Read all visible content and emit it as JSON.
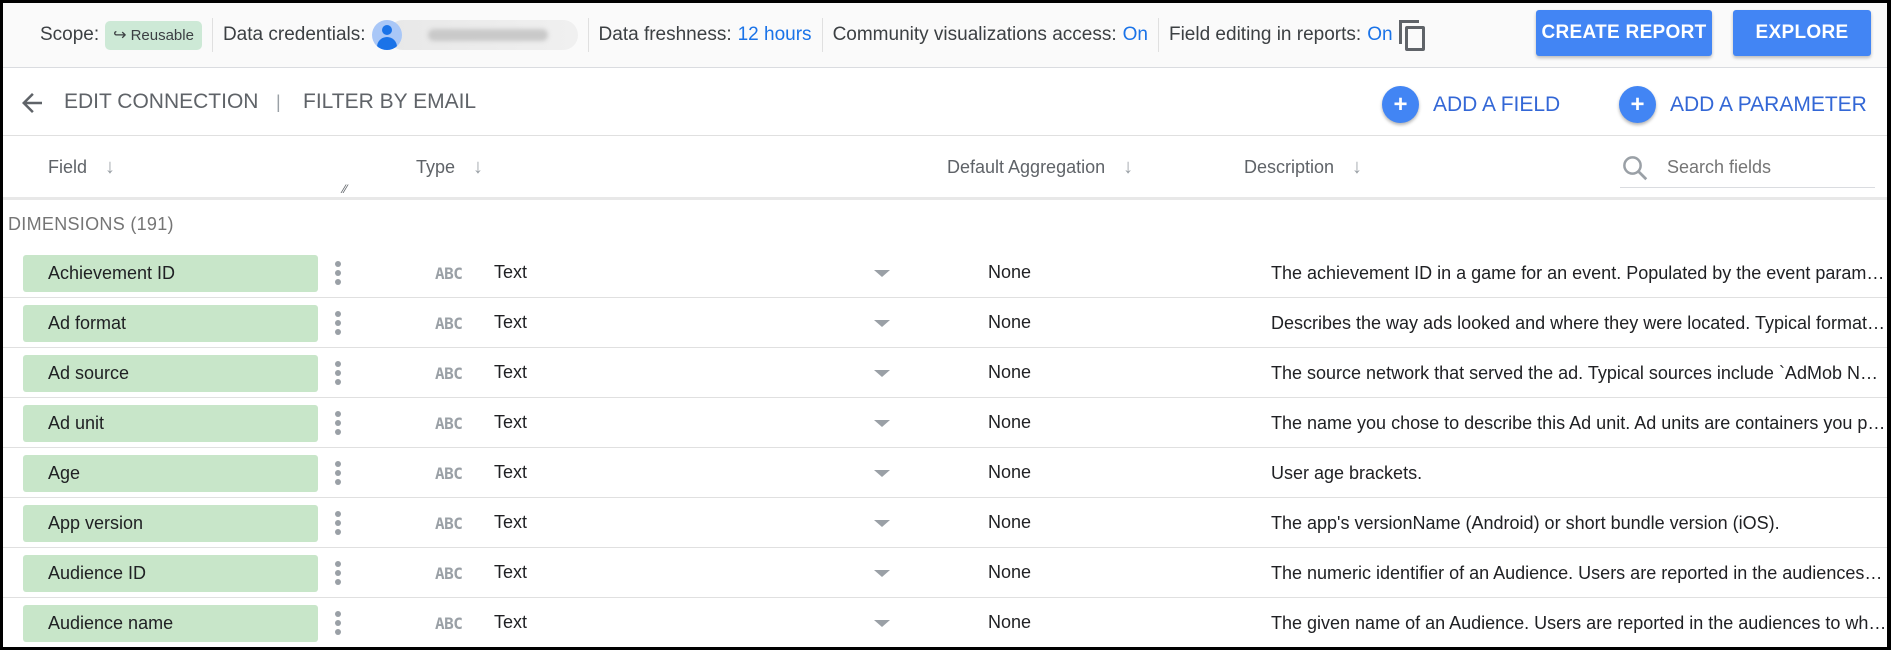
{
  "topbar": {
    "scope_label": "Scope:",
    "scope_value": "Reusable",
    "credentials_label": "Data credentials:",
    "freshness_label": "Data freshness:",
    "freshness_value": "12 hours",
    "community_label": "Community visualizations access:",
    "community_value": "On",
    "field_editing_label": "Field editing in reports:",
    "field_editing_value": "On",
    "create_report_label": "CREATE REPORT",
    "explore_label": "EXPLORE"
  },
  "subheader": {
    "breadcrumb_1": "EDIT CONNECTION",
    "separator": "|",
    "breadcrumb_2": "FILTER BY EMAIL",
    "add_field_label": "ADD A FIELD",
    "add_parameter_label": "ADD A PARAMETER"
  },
  "columns": {
    "field": "Field",
    "type": "Type",
    "aggregation": "Default Aggregation",
    "description": "Description",
    "search_placeholder": "Search fields"
  },
  "section": {
    "title": "DIMENSIONS (191)"
  },
  "rows": [
    {
      "field": "Achievement ID",
      "type_icon": "ABC",
      "type": "Text",
      "aggregation": "None",
      "description": "The achievement ID in a game for an event. Populated by the event parameter achievement_id."
    },
    {
      "field": "Ad format",
      "type_icon": "ABC",
      "type": "Text",
      "aggregation": "None",
      "description": "Describes the way ads looked and where they were located. Typical formats include banner, interstitial."
    },
    {
      "field": "Ad source",
      "type_icon": "ABC",
      "type": "Text",
      "aggregation": "None",
      "description": "The source network that served the ad. Typical sources include `AdMob Network`."
    },
    {
      "field": "Ad unit",
      "type_icon": "ABC",
      "type": "Text",
      "aggregation": "None",
      "description": "The name you chose to describe this Ad unit. Ad units are containers you place in your apps."
    },
    {
      "field": "Age",
      "type_icon": "ABC",
      "type": "Text",
      "aggregation": "None",
      "description": "User age brackets."
    },
    {
      "field": "App version",
      "type_icon": "ABC",
      "type": "Text",
      "aggregation": "None",
      "description": "The app's versionName (Android) or short bundle version (iOS)."
    },
    {
      "field": "Audience ID",
      "type_icon": "ABC",
      "type": "Text",
      "aggregation": "None",
      "description": "The numeric identifier of an Audience. Users are reported in the audiences to which they belonged."
    },
    {
      "field": "Audience name",
      "type_icon": "ABC",
      "type": "Text",
      "aggregation": "None",
      "description": "The given name of an Audience. Users are reported in the audiences to which they belonged."
    }
  ]
}
